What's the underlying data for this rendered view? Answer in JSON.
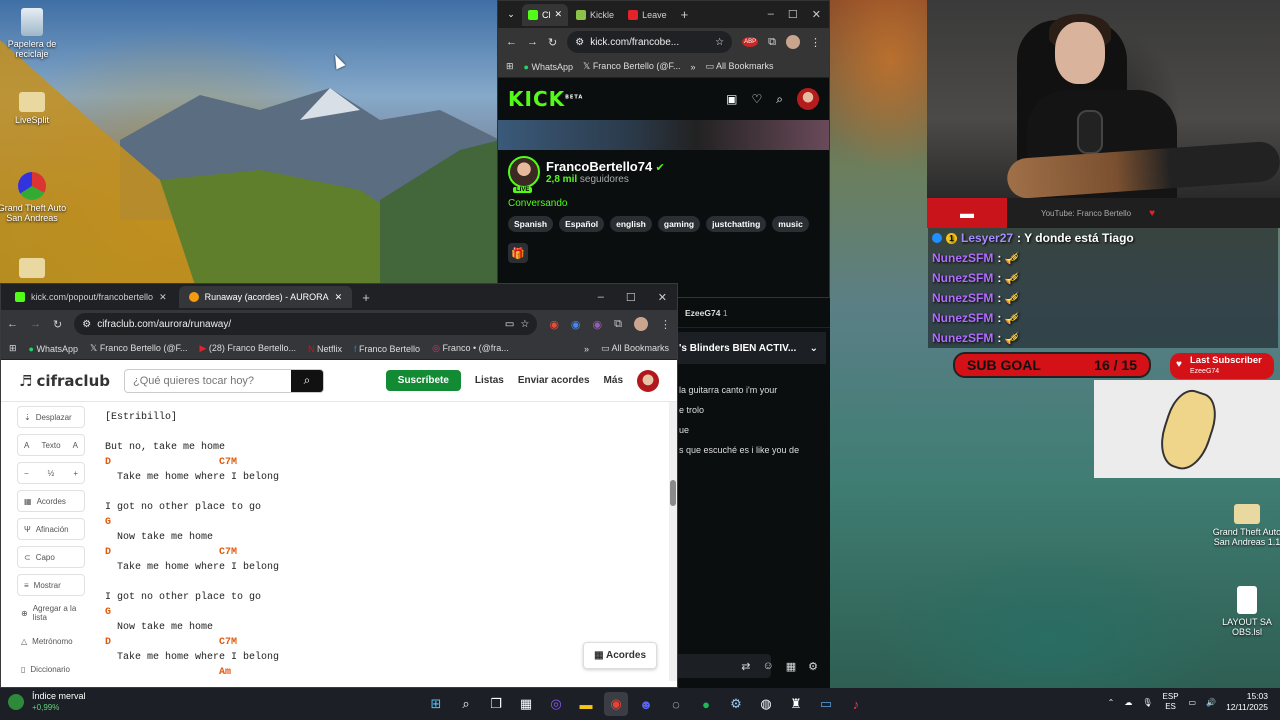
{
  "desktop": {
    "icons": [
      {
        "label": "Papelera de reciclaje",
        "icon": "recycle-bin-icon"
      },
      {
        "label": "LiveSplit",
        "icon": "folder-icon"
      },
      {
        "label": "Grand Theft Auto San Andreas",
        "icon": "gta-icon"
      },
      {
        "label": "",
        "icon": "folder-icon"
      },
      {
        "label": "Grand Theft Auto San Andreas 1.1",
        "icon": "folder-icon"
      },
      {
        "label": "LAYOUT SA OBS.lsl",
        "icon": "file-icon"
      }
    ]
  },
  "kick_window": {
    "tabs": [
      "Cl",
      "Kickle",
      "Leave"
    ],
    "url": "kick.com/francobe...",
    "bookmarks": [
      "WhatsApp",
      "Franco Bertello (@F...",
      "All Bookmarks"
    ],
    "logo": "KICK",
    "logo_badge": "BETA",
    "streamer": "FrancoBertello74",
    "followers_count": "2,8 mil",
    "followers_label": "seguidores",
    "live_label": "LIVE",
    "category": "Conversando",
    "tags": [
      "Spanish",
      "Español",
      "english",
      "gaming",
      "justchatting",
      "music"
    ],
    "chat": {
      "top_user": "EzeeG74",
      "top_count": "1",
      "pinned": "'s Blinders BIEN ACTIV...",
      "messages": [
        "la guitarra canto i'm your",
        "e trolo",
        "ue",
        "s que escuché es i like you de"
      ]
    }
  },
  "cifra_window": {
    "tabs": [
      "kick.com/popout/francobertello",
      "Runaway (acordes) - AURORA"
    ],
    "url": "cifraclub.com/aurora/runaway/",
    "bookmarks": [
      "WhatsApp",
      "Franco Bertello (@F...",
      "(28) Franco Bertello...",
      "Netflix",
      "Franco Bertello",
      "Franco • (@fra...",
      "All Bookmarks"
    ],
    "header": {
      "logo": "cifraclub",
      "search_placeholder": "¿Qué quieres tocar hoy?",
      "subscribe": "Suscríbete",
      "links": [
        "Listas",
        "Enviar acordes",
        "Más"
      ]
    },
    "sidebar": {
      "scroll": "Desplazar",
      "text_small": "A",
      "text_label": "Texto",
      "text_big": "A",
      "minus": "−",
      "half": "½",
      "plus": "+",
      "items": [
        "Acordes",
        "Afinación",
        "Capo",
        "Mostrar",
        "Agregar a la lista",
        "Metrónomo",
        "Diccionario"
      ]
    },
    "song_lines": [
      {
        "t": "[Estribillo]",
        "k": "text"
      },
      {
        "t": "",
        "k": "text"
      },
      {
        "t": "But no, take me home",
        "k": "text"
      },
      {
        "t": "D                  C7M",
        "k": "chord"
      },
      {
        "t": "  Take me home where I belong",
        "k": "text"
      },
      {
        "t": "",
        "k": "text"
      },
      {
        "t": "I got no other place to go",
        "k": "text"
      },
      {
        "t": "G",
        "k": "chord"
      },
      {
        "t": "  Now take me home",
        "k": "text"
      },
      {
        "t": "D                  C7M",
        "k": "chord"
      },
      {
        "t": "  Take me home where I belong",
        "k": "text"
      },
      {
        "t": "",
        "k": "text"
      },
      {
        "t": "I got no other place to go",
        "k": "text"
      },
      {
        "t": "G",
        "k": "chord"
      },
      {
        "t": "  Now take me home",
        "k": "text"
      },
      {
        "t": "D                  C7M",
        "k": "chord"
      },
      {
        "t": "  Take me home where I belong",
        "k": "text"
      },
      {
        "t": "                   Am",
        "k": "chord"
      }
    ],
    "acordes_button": "Acordes"
  },
  "stream_overlay": {
    "youtube_text": "YouTube: Franco Bertello",
    "chat": [
      {
        "user": "Lesyer27",
        "msg": ": Y donde está Tiago",
        "badge": "1"
      },
      {
        "user": "NunezSFM",
        "msg": ": 🎺"
      },
      {
        "user": "NunezSFM",
        "msg": ": 🎺"
      },
      {
        "user": "NunezSFM",
        "msg": ": 🎺"
      },
      {
        "user": "NunezSFM",
        "msg": ": 🎺"
      },
      {
        "user": "NunezSFM",
        "msg": ": 🎺"
      }
    ],
    "sub_goal_label": "SUB GOAL",
    "sub_goal_value": "16 / 15",
    "last_sub_label": "Last Subscriber",
    "last_sub_name": "EzeeG74"
  },
  "taskbar": {
    "widget_title": "Índice merval",
    "widget_value": "+0,99%",
    "lang_top": "ESP",
    "lang_bottom": "ES",
    "time": "15:03",
    "date": "12/11/2025"
  },
  "colors": {
    "kick_green": "#53fc18",
    "chord_orange": "#e0590c",
    "cifra_green": "#138a34",
    "overlay_red": "#d31116"
  }
}
